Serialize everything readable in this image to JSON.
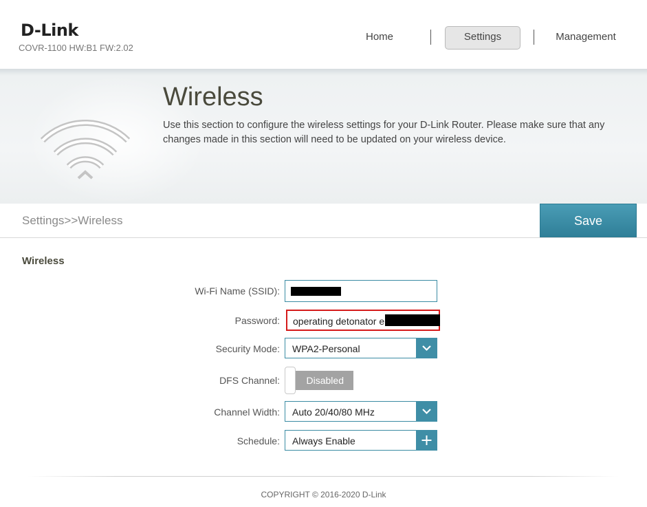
{
  "brand": {
    "logo_text": "D-Link",
    "model_info": "COVR-1100 HW:B1 FW:2.02"
  },
  "nav": {
    "home": "Home",
    "settings": "Settings",
    "management": "Management",
    "active": "Settings"
  },
  "banner": {
    "title": "Wireless",
    "description": "Use this section to configure the wireless settings for your D-Link Router. Please make sure that any changes made in this section will need to be updated on your wireless device.",
    "icon": "wifi-icon"
  },
  "breadcrumb": "Settings>>Wireless",
  "save_label": "Save",
  "form": {
    "section_title": "Wireless",
    "ssid": {
      "label": "Wi-Fi Name (SSID):",
      "value": ""
    },
    "password": {
      "label": "Password:",
      "value": "operating detonator e"
    },
    "security_mode": {
      "label": "Security Mode:",
      "value": "WPA2-Personal",
      "icon": "chevron-down-icon"
    },
    "dfs_channel": {
      "label": "DFS Channel:",
      "state": "Disabled"
    },
    "channel_width": {
      "label": "Channel Width:",
      "value": "Auto 20/40/80 MHz",
      "icon": "chevron-down-icon"
    },
    "schedule": {
      "label": "Schedule:",
      "value": "Always Enable",
      "icon": "plus-icon"
    }
  },
  "footer": {
    "copyright": "COPYRIGHT © 2016-2020 D-Link"
  },
  "colors": {
    "accent": "#3f8ea6",
    "highlight_border": "#d51a1a",
    "toggle_off": "#a3a3a3"
  }
}
